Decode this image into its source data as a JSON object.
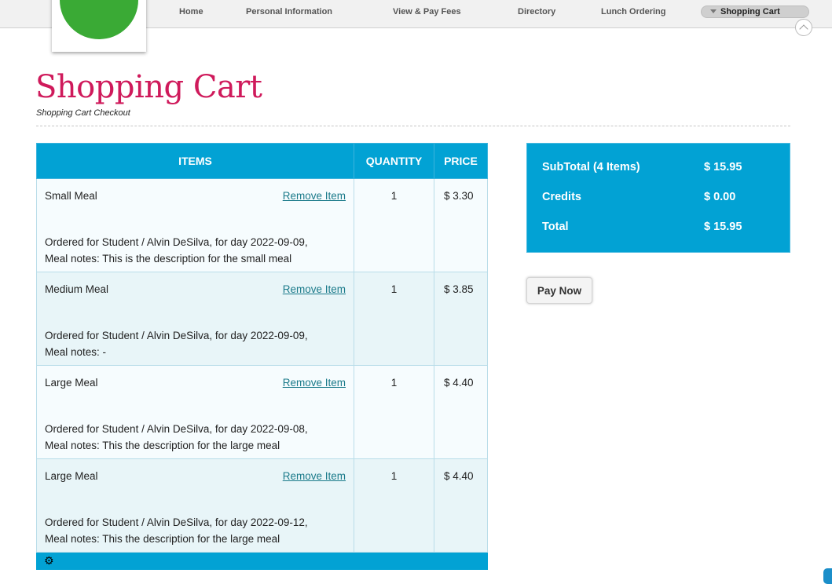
{
  "nav": {
    "items": [
      {
        "label": "Home"
      },
      {
        "label": "Personal Information"
      },
      {
        "label": "View & Pay Fees"
      },
      {
        "label": "Directory"
      },
      {
        "label": "Lunch Ordering"
      }
    ],
    "active_label": "Shopping Cart"
  },
  "logo": {
    "icon": "building-columns-icon",
    "color": "#3aaa35"
  },
  "header": {
    "title": "Shopping Cart",
    "subtitle": "Shopping Cart Checkout"
  },
  "cart": {
    "columns": {
      "items": "ITEMS",
      "quantity": "QUANTITY",
      "price": "PRICE"
    },
    "remove_label": "Remove Item",
    "rows": [
      {
        "name": "Small Meal",
        "line1": "Ordered for Student / Alvin DeSilva, for day 2022-09-09,",
        "line2": "Meal notes: This is the description for the small meal",
        "quantity": "1",
        "price": "$ 3.30"
      },
      {
        "name": "Medium Meal",
        "line1": "Ordered for Student / Alvin DeSilva, for day 2022-09-09,",
        "line2": "Meal notes: -",
        "quantity": "1",
        "price": "$ 3.85"
      },
      {
        "name": "Large Meal",
        "line1": "Ordered for Student / Alvin DeSilva, for day 2022-09-08,",
        "line2": "Meal notes: This the description for the large meal",
        "quantity": "1",
        "price": "$ 4.40"
      },
      {
        "name": "Large Meal",
        "line1": "Ordered for Student / Alvin DeSilva, for day 2022-09-12,",
        "line2": "Meal notes: This the description for the large meal",
        "quantity": "1",
        "price": "$ 4.40"
      }
    ],
    "footer_icon": "gear-icon"
  },
  "summary": {
    "subtotal_label": "SubTotal (4 Items)",
    "subtotal_value": "$ 15.95",
    "credits_label": "Credits",
    "credits_value": "$ 0.00",
    "total_label": "Total",
    "total_value": "$ 15.95"
  },
  "pay_button": "Pay Now",
  "colors": {
    "accent": "#02a2d4",
    "title": "#cf1a5b",
    "link": "#1a7a8a"
  }
}
